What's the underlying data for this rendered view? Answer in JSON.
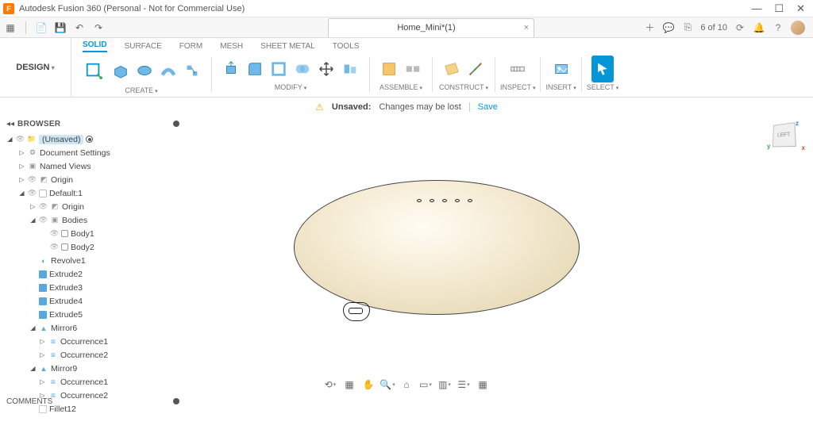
{
  "titlebar": {
    "app_title": "Autodesk Fusion 360 (Personal - Not for Commercial Use)",
    "logo_letter": "F"
  },
  "quick_access": {
    "data_panel": "▦",
    "file": "▾",
    "save": "💾",
    "undo": "↶",
    "redo": "↷"
  },
  "document_tab": {
    "name": "Home_Mini*(1)"
  },
  "app_bar": {
    "new": "＋",
    "comment": "💬",
    "ext": "⎋",
    "job_status": "6 of 10",
    "updates": "⟳",
    "notif": "🔔",
    "help": "?"
  },
  "workspace": {
    "label": "DESIGN"
  },
  "ribbon_tabs": {
    "solid": "SOLID",
    "surface": "SURFACE",
    "form": "FORM",
    "mesh": "MESH",
    "sheet_metal": "SHEET METAL",
    "tools": "TOOLS"
  },
  "ribbon_groups": {
    "create": "CREATE",
    "modify": "MODIFY",
    "assemble": "ASSEMBLE",
    "construct": "CONSTRUCT",
    "inspect": "INSPECT",
    "insert": "INSERT",
    "select": "SELECT"
  },
  "info_bar": {
    "label": "Unsaved:",
    "message": "Changes may be lost",
    "action": "Save"
  },
  "browser": {
    "title": "BROWSER",
    "root": "(Unsaved)",
    "doc_settings": "Document Settings",
    "named_views": "Named Views",
    "origin_root": "Origin",
    "component1": "Default:1",
    "origin1": "Origin",
    "bodies": "Bodies",
    "body1": "Body1",
    "body2": "Body2",
    "revolve1": "Revolve1",
    "extrude2": "Extrude2",
    "extrude3": "Extrude3",
    "extrude4": "Extrude4",
    "extrude5": "Extrude5",
    "mirror6": "Mirror6",
    "occ1a": "Occurrence1",
    "occ2a": "Occurrence2",
    "mirror9": "Mirror9",
    "occ1b": "Occurrence1",
    "occ2b": "Occurrence2",
    "fillet12": "Fillet12"
  },
  "viewcube": {
    "face": "LEFT",
    "x": "x",
    "y": "y",
    "z": "z"
  },
  "navbar": {
    "orbit": "⟲",
    "lookat": "▦",
    "pan": "✋",
    "zoom": "🔍",
    "fit": "⌂",
    "display": "▭",
    "grid": "▥",
    "views": "☰",
    "snap": "▦"
  },
  "comments": {
    "title": "COMMENTS"
  }
}
